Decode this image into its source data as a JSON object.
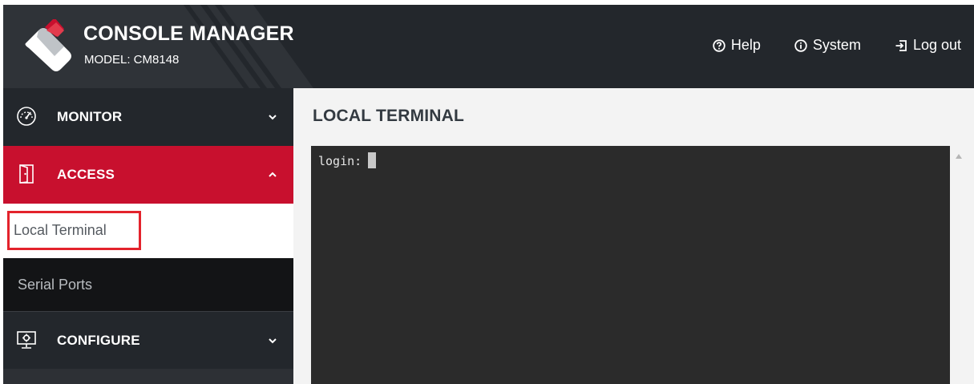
{
  "brand": {
    "title": "CONSOLE MANAGER",
    "model": "MODEL: CM8148"
  },
  "top_nav": {
    "help": "Help",
    "system": "System",
    "logout": "Log out"
  },
  "sidebar": {
    "monitor": "MONITOR",
    "access": "ACCESS",
    "local_terminal": "Local Terminal",
    "serial_ports": "Serial Ports",
    "configure": "CONFIGURE"
  },
  "main": {
    "title": "LOCAL TERMINAL"
  },
  "terminal": {
    "prompt": "login:"
  },
  "colors": {
    "header_bg": "#23272c",
    "accent_red": "#c8102e",
    "highlight_border": "#e3232c",
    "terminal_bg": "#2b2b2b"
  },
  "icons": {
    "monitor": "speedometer-icon",
    "access": "door-icon",
    "configure": "monitor-gear-icon",
    "help": "question-circle-icon",
    "system": "info-circle-icon",
    "logout": "sign-out-icon"
  }
}
